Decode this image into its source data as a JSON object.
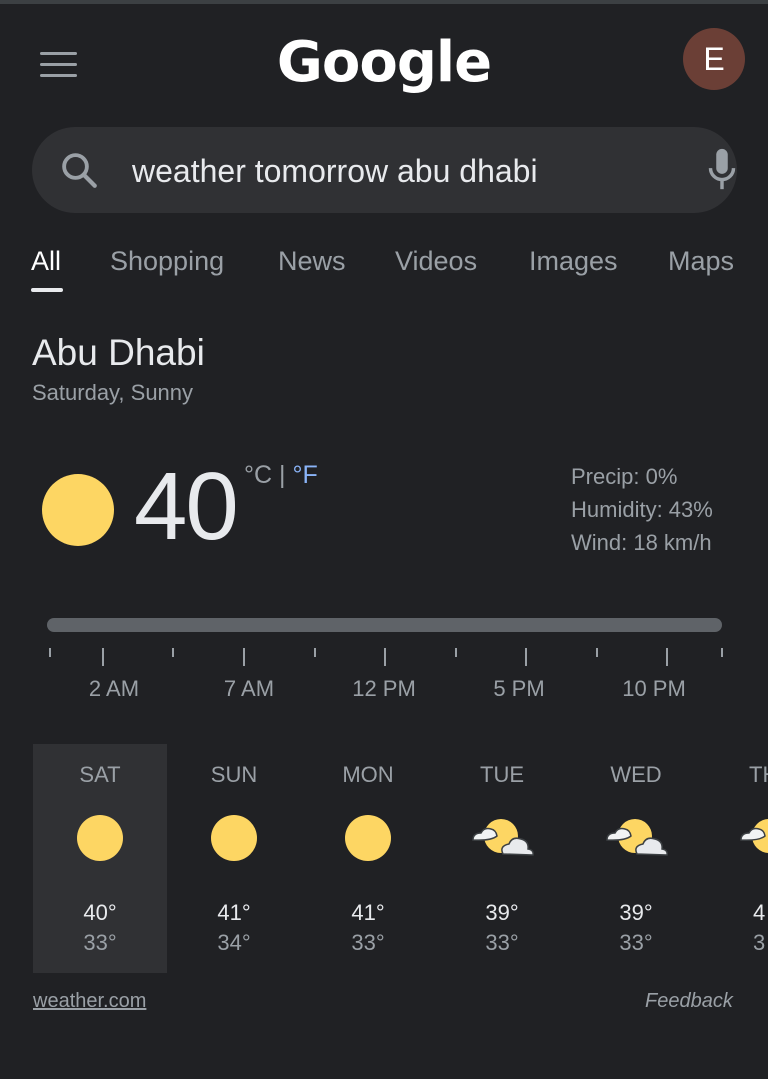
{
  "header": {
    "logo_text": "Google",
    "avatar_initial": "E",
    "avatar_color": "#6b3f36"
  },
  "search": {
    "query": "weather tomorrow abu dhabi",
    "search_icon": "search-icon",
    "mic_icon": "mic-icon"
  },
  "tabs": [
    {
      "label": "All",
      "active": true
    },
    {
      "label": "Shopping"
    },
    {
      "label": "News"
    },
    {
      "label": "Videos"
    },
    {
      "label": "Images"
    },
    {
      "label": "Maps"
    }
  ],
  "weather": {
    "location": "Abu Dhabi",
    "condition": "Saturday, Sunny",
    "temperature": "40",
    "unit_c": "°C",
    "unit_sep": " | ",
    "unit_f": "°F",
    "precip": "Precip: 0%",
    "humidity": "Humidity: 43%",
    "wind": "Wind: 18 km/h",
    "icon": "sun-icon",
    "accent_color": "#fdd663",
    "link_color": "#8ab4f8",
    "time_labels": [
      "2 AM",
      "7 AM",
      "12 PM",
      "5 PM",
      "10 PM"
    ],
    "days": [
      {
        "name": "SAT",
        "hi": "40°",
        "lo": "33°",
        "icon": "sunny",
        "selected": true
      },
      {
        "name": "SUN",
        "hi": "41°",
        "lo": "34°",
        "icon": "sunny"
      },
      {
        "name": "MON",
        "hi": "41°",
        "lo": "33°",
        "icon": "sunny"
      },
      {
        "name": "TUE",
        "hi": "39°",
        "lo": "33°",
        "icon": "partly-cloudy"
      },
      {
        "name": "WED",
        "hi": "39°",
        "lo": "33°",
        "icon": "partly-cloudy"
      },
      {
        "name": "TH",
        "hi": "4",
        "lo": "3",
        "icon": "partly-cloudy"
      }
    ],
    "source": "weather.com",
    "feedback": "Feedback"
  }
}
